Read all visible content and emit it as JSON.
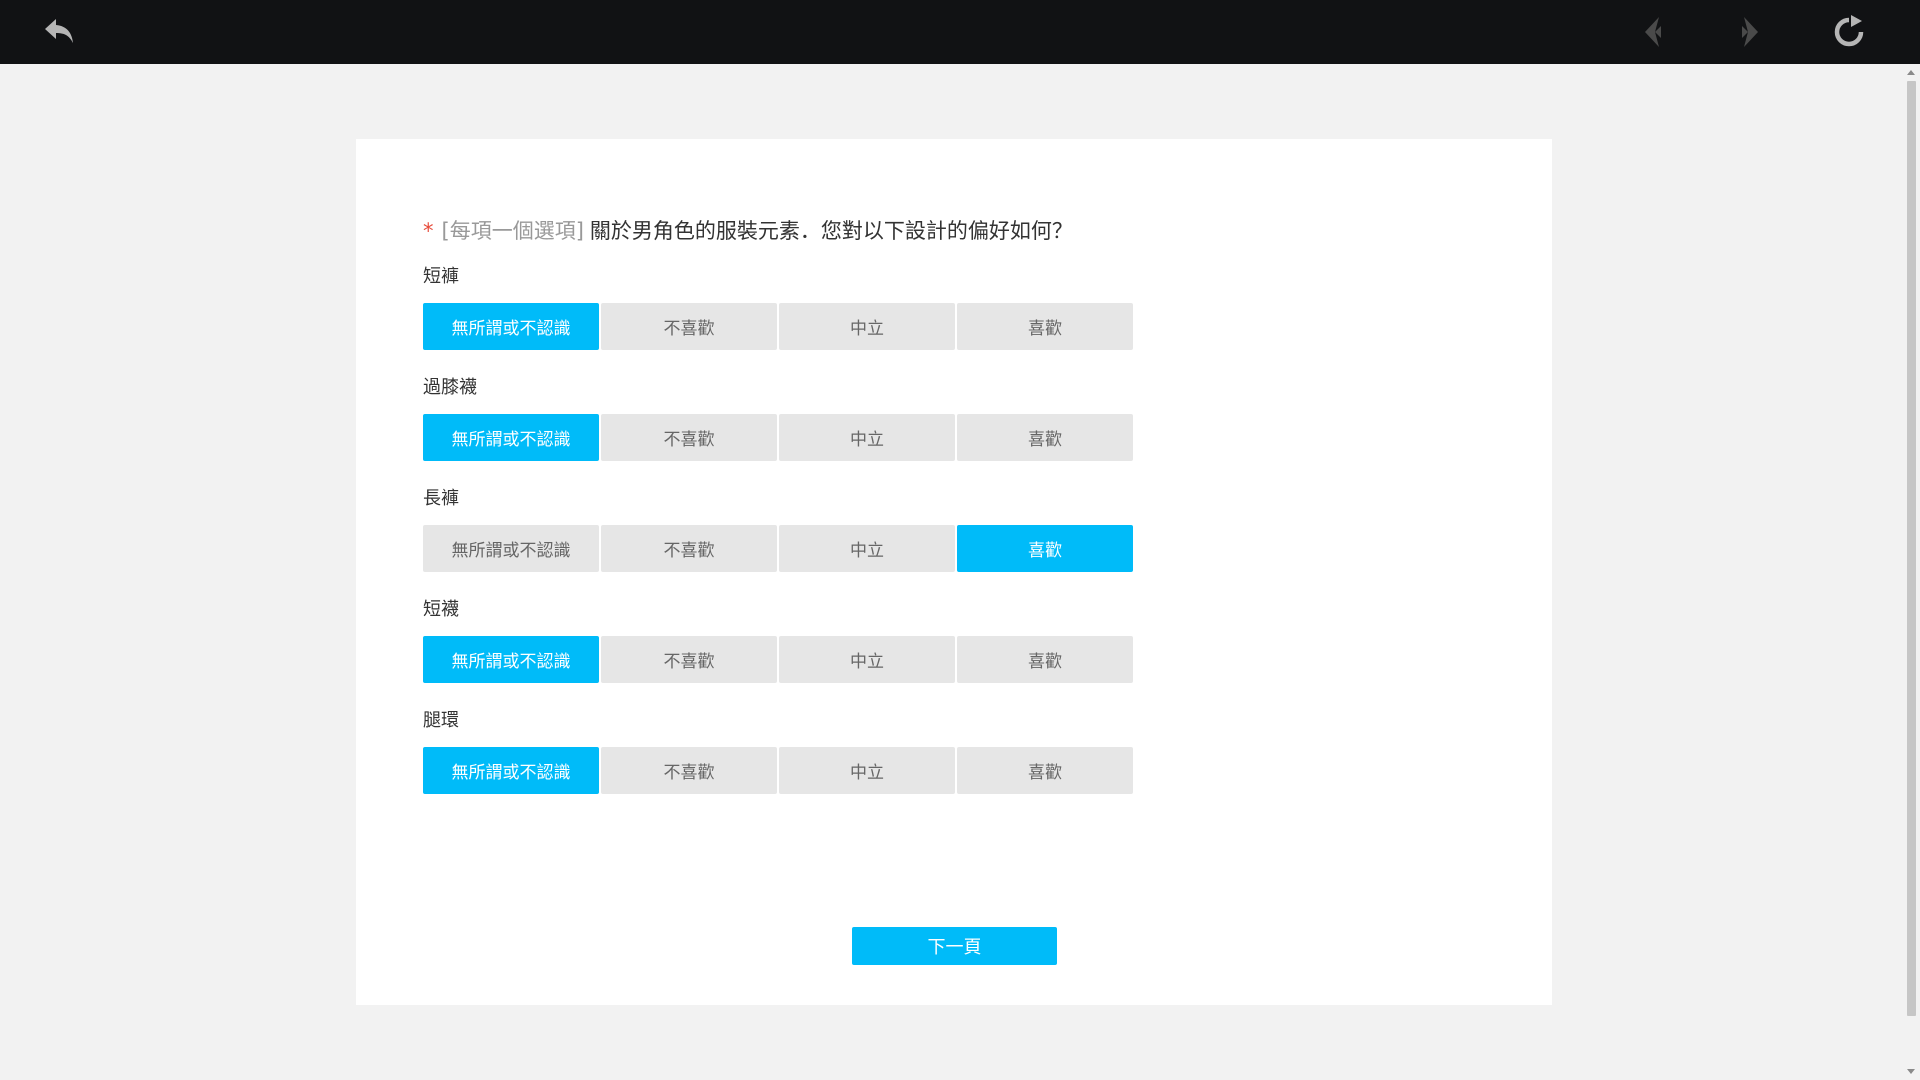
{
  "question": {
    "required_mark": "*",
    "hint": "[每項一個選項]",
    "text": "關於男角色的服裝元素．您對以下設計的偏好如何？"
  },
  "options": [
    "無所謂或不認識",
    "不喜歡",
    "中立",
    "喜歡"
  ],
  "items": [
    {
      "label": "短褲",
      "selected_index": 0
    },
    {
      "label": "過膝襪",
      "selected_index": 0
    },
    {
      "label": "長褲",
      "selected_index": 3
    },
    {
      "label": "短襪",
      "selected_index": 0
    },
    {
      "label": "腿環",
      "selected_index": 0
    }
  ],
  "next_button": "下一頁",
  "colors": {
    "accent": "#00bbf9",
    "option_bg": "#e6e6e6",
    "topbar": "#111214",
    "required": "#e74c3c"
  },
  "icons": {
    "back": "undo-arrow-icon",
    "prev": "chevron-left-icon",
    "next": "chevron-right-icon",
    "reload": "reload-icon"
  }
}
